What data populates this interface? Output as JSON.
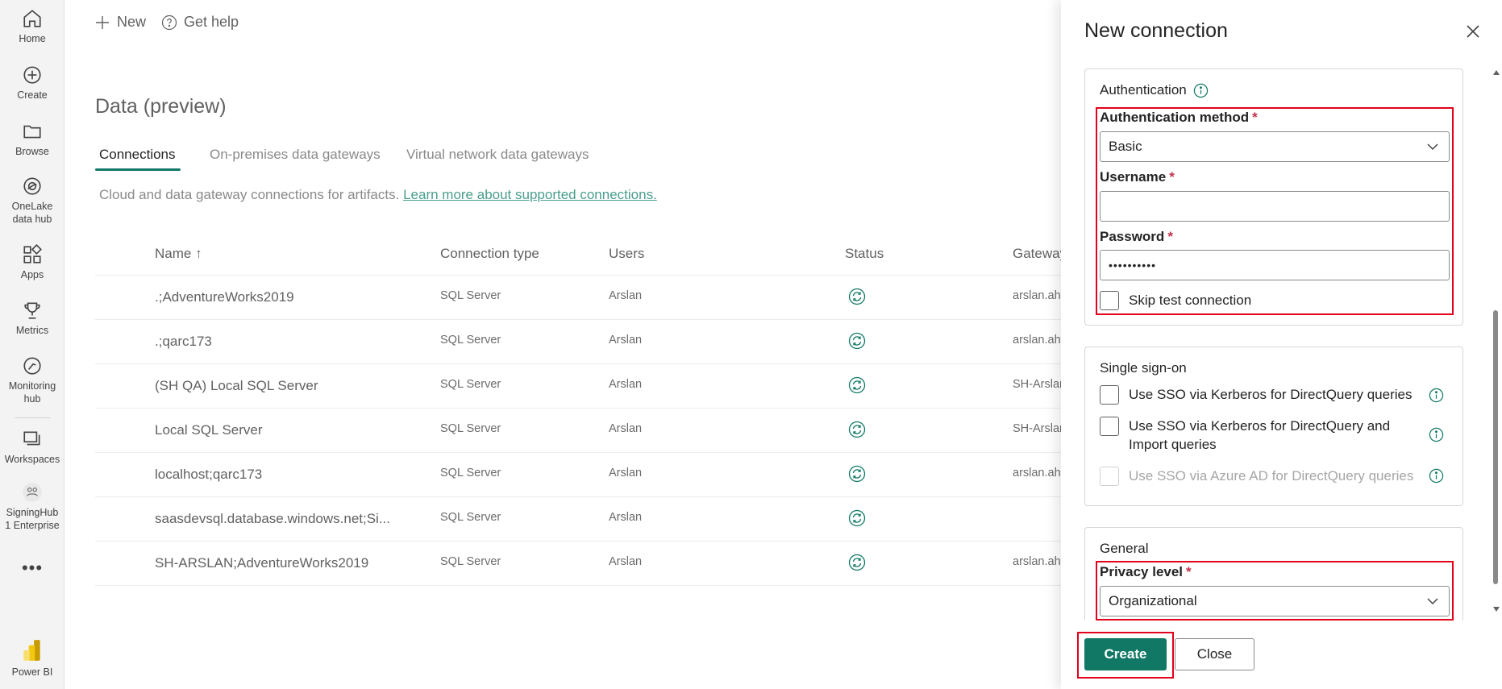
{
  "nav": {
    "home": "Home",
    "create": "Create",
    "browse": "Browse",
    "onelake_line1": "OneLake",
    "onelake_line2": "data hub",
    "apps": "Apps",
    "metrics": "Metrics",
    "monitoring_line1": "Monitoring",
    "monitoring_line2": "hub",
    "workspaces": "Workspaces",
    "workspace_name_line1": "SigningHub",
    "workspace_name_line2": "1 Enterprise",
    "more": "•••",
    "product": "Power BI"
  },
  "toolbar": {
    "new_label": "New",
    "help_label": "Get help"
  },
  "page": {
    "title": "Data (preview)",
    "tabs": [
      "Connections",
      "On-premises data gateways",
      "Virtual network data gateways"
    ],
    "description": "Cloud and data gateway connections for artifacts.",
    "learn_more": "Learn more about supported connections."
  },
  "table": {
    "headers": {
      "name": "Name ↑",
      "type": "Connection type",
      "users": "Users",
      "status": "Status",
      "gateway": "Gateway"
    },
    "rows": [
      {
        "name": ".;AdventureWorks2019",
        "type": "SQL Server",
        "users": "Arslan",
        "gateway": "arslan.ahm"
      },
      {
        "name": ".;qarc173",
        "type": "SQL Server",
        "users": "Arslan",
        "gateway": "arslan.ahm"
      },
      {
        "name": "(SH QA) Local SQL Server",
        "type": "SQL Server",
        "users": "Arslan",
        "gateway": "SH-Arslan"
      },
      {
        "name": "Local SQL Server",
        "type": "SQL Server",
        "users": "Arslan",
        "gateway": "SH-Arslan"
      },
      {
        "name": "localhost;qarc173",
        "type": "SQL Server",
        "users": "Arslan",
        "gateway": "arslan.ahm"
      },
      {
        "name": "saasdevsql.database.windows.net;Si...",
        "type": "SQL Server",
        "users": "Arslan",
        "gateway": ""
      },
      {
        "name": "SH-ARSLAN;AdventureWorks2019",
        "type": "SQL Server",
        "users": "Arslan",
        "gateway": "arslan.ahm"
      }
    ]
  },
  "panel": {
    "title": "New connection",
    "auth": {
      "heading": "Authentication",
      "method_label": "Authentication method",
      "method_value": "Basic",
      "username_label": "Username",
      "username_value": "",
      "password_label": "Password",
      "password_value": "••••••••••",
      "skip_test_label": "Skip test connection",
      "required_mark": "*"
    },
    "sso": {
      "heading": "Single sign-on",
      "option1": "Use SSO via Kerberos for DirectQuery queries",
      "option2": "Use SSO via Kerberos for DirectQuery and Import queries",
      "option3": "Use SSO via Azure AD for DirectQuery queries"
    },
    "general": {
      "heading": "General",
      "privacy_label": "Privacy level",
      "privacy_value": "Organizational"
    },
    "create_button": "Create",
    "close_button": "Close"
  },
  "colors": {
    "accent": "#117865",
    "highlight": "#e3001b",
    "required": "#c4314b"
  }
}
